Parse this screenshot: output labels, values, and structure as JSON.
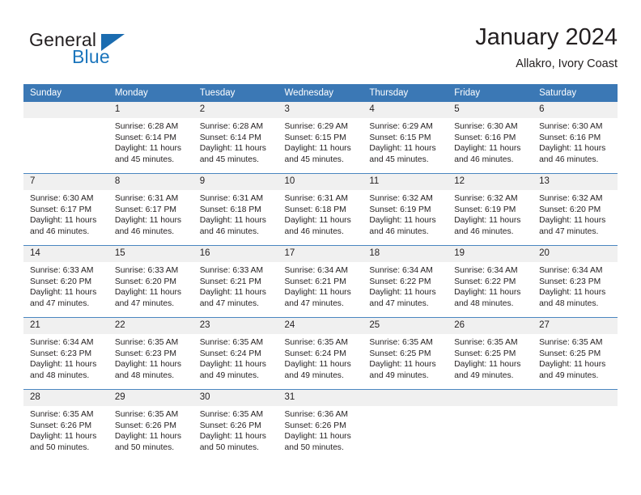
{
  "brand": {
    "name_part1": "General",
    "name_part2": "Blue",
    "logo_icon": "triangle-logo-icon",
    "accent_color": "#1b75bc"
  },
  "header": {
    "title": "January 2024",
    "subtitle": "Allakro, Ivory Coast"
  },
  "calendar": {
    "header_bg": "#3b78b5",
    "daynum_bg": "#f0f0f0",
    "weekday_labels": [
      "Sunday",
      "Monday",
      "Tuesday",
      "Wednesday",
      "Thursday",
      "Friday",
      "Saturday"
    ],
    "weeks": [
      [
        {
          "day": "",
          "empty": true,
          "sunrise": "",
          "sunset": "",
          "daylight": ""
        },
        {
          "day": "1",
          "sunrise": "Sunrise: 6:28 AM",
          "sunset": "Sunset: 6:14 PM",
          "daylight": "Daylight: 11 hours and 45 minutes."
        },
        {
          "day": "2",
          "sunrise": "Sunrise: 6:28 AM",
          "sunset": "Sunset: 6:14 PM",
          "daylight": "Daylight: 11 hours and 45 minutes."
        },
        {
          "day": "3",
          "sunrise": "Sunrise: 6:29 AM",
          "sunset": "Sunset: 6:15 PM",
          "daylight": "Daylight: 11 hours and 45 minutes."
        },
        {
          "day": "4",
          "sunrise": "Sunrise: 6:29 AM",
          "sunset": "Sunset: 6:15 PM",
          "daylight": "Daylight: 11 hours and 45 minutes."
        },
        {
          "day": "5",
          "sunrise": "Sunrise: 6:30 AM",
          "sunset": "Sunset: 6:16 PM",
          "daylight": "Daylight: 11 hours and 46 minutes."
        },
        {
          "day": "6",
          "sunrise": "Sunrise: 6:30 AM",
          "sunset": "Sunset: 6:16 PM",
          "daylight": "Daylight: 11 hours and 46 minutes."
        }
      ],
      [
        {
          "day": "7",
          "sunrise": "Sunrise: 6:30 AM",
          "sunset": "Sunset: 6:17 PM",
          "daylight": "Daylight: 11 hours and 46 minutes."
        },
        {
          "day": "8",
          "sunrise": "Sunrise: 6:31 AM",
          "sunset": "Sunset: 6:17 PM",
          "daylight": "Daylight: 11 hours and 46 minutes."
        },
        {
          "day": "9",
          "sunrise": "Sunrise: 6:31 AM",
          "sunset": "Sunset: 6:18 PM",
          "daylight": "Daylight: 11 hours and 46 minutes."
        },
        {
          "day": "10",
          "sunrise": "Sunrise: 6:31 AM",
          "sunset": "Sunset: 6:18 PM",
          "daylight": "Daylight: 11 hours and 46 minutes."
        },
        {
          "day": "11",
          "sunrise": "Sunrise: 6:32 AM",
          "sunset": "Sunset: 6:19 PM",
          "daylight": "Daylight: 11 hours and 46 minutes."
        },
        {
          "day": "12",
          "sunrise": "Sunrise: 6:32 AM",
          "sunset": "Sunset: 6:19 PM",
          "daylight": "Daylight: 11 hours and 46 minutes."
        },
        {
          "day": "13",
          "sunrise": "Sunrise: 6:32 AM",
          "sunset": "Sunset: 6:20 PM",
          "daylight": "Daylight: 11 hours and 47 minutes."
        }
      ],
      [
        {
          "day": "14",
          "sunrise": "Sunrise: 6:33 AM",
          "sunset": "Sunset: 6:20 PM",
          "daylight": "Daylight: 11 hours and 47 minutes."
        },
        {
          "day": "15",
          "sunrise": "Sunrise: 6:33 AM",
          "sunset": "Sunset: 6:20 PM",
          "daylight": "Daylight: 11 hours and 47 minutes."
        },
        {
          "day": "16",
          "sunrise": "Sunrise: 6:33 AM",
          "sunset": "Sunset: 6:21 PM",
          "daylight": "Daylight: 11 hours and 47 minutes."
        },
        {
          "day": "17",
          "sunrise": "Sunrise: 6:34 AM",
          "sunset": "Sunset: 6:21 PM",
          "daylight": "Daylight: 11 hours and 47 minutes."
        },
        {
          "day": "18",
          "sunrise": "Sunrise: 6:34 AM",
          "sunset": "Sunset: 6:22 PM",
          "daylight": "Daylight: 11 hours and 47 minutes."
        },
        {
          "day": "19",
          "sunrise": "Sunrise: 6:34 AM",
          "sunset": "Sunset: 6:22 PM",
          "daylight": "Daylight: 11 hours and 48 minutes."
        },
        {
          "day": "20",
          "sunrise": "Sunrise: 6:34 AM",
          "sunset": "Sunset: 6:23 PM",
          "daylight": "Daylight: 11 hours and 48 minutes."
        }
      ],
      [
        {
          "day": "21",
          "sunrise": "Sunrise: 6:34 AM",
          "sunset": "Sunset: 6:23 PM",
          "daylight": "Daylight: 11 hours and 48 minutes."
        },
        {
          "day": "22",
          "sunrise": "Sunrise: 6:35 AM",
          "sunset": "Sunset: 6:23 PM",
          "daylight": "Daylight: 11 hours and 48 minutes."
        },
        {
          "day": "23",
          "sunrise": "Sunrise: 6:35 AM",
          "sunset": "Sunset: 6:24 PM",
          "daylight": "Daylight: 11 hours and 49 minutes."
        },
        {
          "day": "24",
          "sunrise": "Sunrise: 6:35 AM",
          "sunset": "Sunset: 6:24 PM",
          "daylight": "Daylight: 11 hours and 49 minutes."
        },
        {
          "day": "25",
          "sunrise": "Sunrise: 6:35 AM",
          "sunset": "Sunset: 6:25 PM",
          "daylight": "Daylight: 11 hours and 49 minutes."
        },
        {
          "day": "26",
          "sunrise": "Sunrise: 6:35 AM",
          "sunset": "Sunset: 6:25 PM",
          "daylight": "Daylight: 11 hours and 49 minutes."
        },
        {
          "day": "27",
          "sunrise": "Sunrise: 6:35 AM",
          "sunset": "Sunset: 6:25 PM",
          "daylight": "Daylight: 11 hours and 49 minutes."
        }
      ],
      [
        {
          "day": "28",
          "sunrise": "Sunrise: 6:35 AM",
          "sunset": "Sunset: 6:26 PM",
          "daylight": "Daylight: 11 hours and 50 minutes."
        },
        {
          "day": "29",
          "sunrise": "Sunrise: 6:35 AM",
          "sunset": "Sunset: 6:26 PM",
          "daylight": "Daylight: 11 hours and 50 minutes."
        },
        {
          "day": "30",
          "sunrise": "Sunrise: 6:35 AM",
          "sunset": "Sunset: 6:26 PM",
          "daylight": "Daylight: 11 hours and 50 minutes."
        },
        {
          "day": "31",
          "sunrise": "Sunrise: 6:36 AM",
          "sunset": "Sunset: 6:26 PM",
          "daylight": "Daylight: 11 hours and 50 minutes."
        },
        {
          "day": "",
          "empty": true,
          "sunrise": "",
          "sunset": "",
          "daylight": ""
        },
        {
          "day": "",
          "empty": true,
          "sunrise": "",
          "sunset": "",
          "daylight": ""
        },
        {
          "day": "",
          "empty": true,
          "sunrise": "",
          "sunset": "",
          "daylight": ""
        }
      ]
    ]
  }
}
